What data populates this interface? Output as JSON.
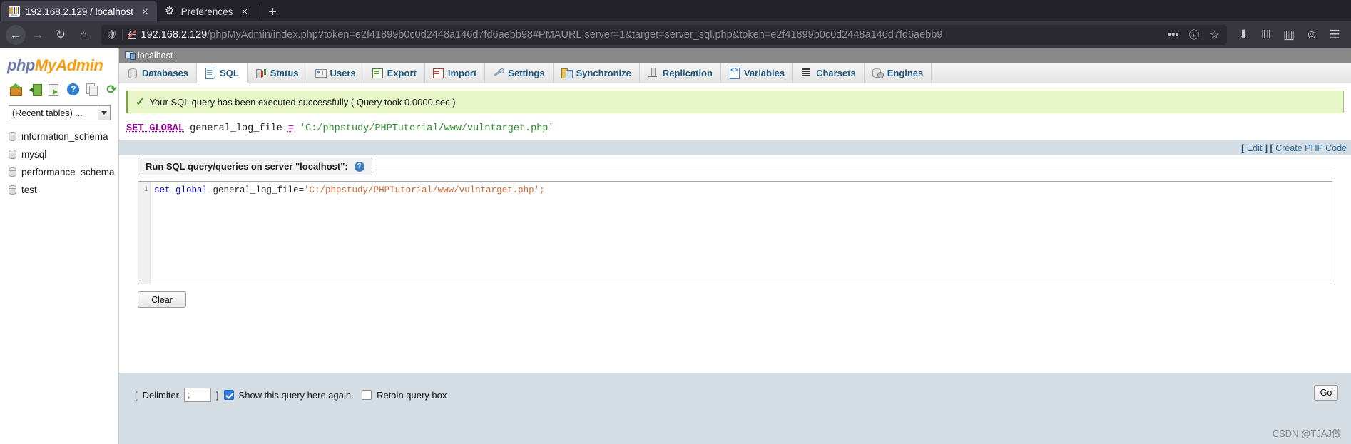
{
  "browser": {
    "tabs": [
      {
        "title": "192.168.2.129 / localhost",
        "favicon": "phpmyadmin-icon",
        "active": true,
        "close_label": "×"
      },
      {
        "title": "Preferences",
        "favicon": "gear-icon",
        "active": false,
        "close_label": "×"
      }
    ],
    "new_tab_label": "+",
    "nav": {
      "back": "←",
      "forward": "→",
      "reload": "↻",
      "home": "⌂"
    },
    "url": {
      "host": "192.168.2.129",
      "path": "/phpMyAdmin/index.php?token=e2f41899b0c0d2448a146d7fd6aebb98#PMAURL:server=1&target=server_sql.php&token=e2f41899b0c0d2448a146d7fd6aebb9",
      "full": "192.168.2.129/phpMyAdmin/index.php?token=e2f41899b0c0d2448a146d7fd6aebb98#PMAURL:server=1&target=server_sql.php&token=e2f41899b0c0d2448a146d7fd6aebb9",
      "more_label": "•••",
      "pocket_label": "ⓥ",
      "star_label": "☆"
    },
    "toolbar_right": {
      "downloads": "⬇",
      "library": "‖‖",
      "sidebar": "▥",
      "account": "☺",
      "menu": "☰"
    }
  },
  "sidebar": {
    "logo": {
      "php": "php",
      "my": "My",
      "admin": "Admin"
    },
    "icons": [
      {
        "name": "home-icon",
        "cls": "ic-home"
      },
      {
        "name": "logout-door-icon",
        "cls": "ic-door"
      },
      {
        "name": "export-doc-icon",
        "cls": "ic-docexp"
      },
      {
        "name": "help-icon",
        "cls": "ic-help"
      },
      {
        "name": "copy-doc-icon",
        "cls": "ic-copy"
      },
      {
        "name": "reload-icon",
        "cls": "ic-refresh"
      }
    ],
    "recent_tables_label": "(Recent tables) ...",
    "databases": [
      "information_schema",
      "mysql",
      "performance_schema",
      "test"
    ]
  },
  "main": {
    "server_label": "localhost",
    "tabs": [
      {
        "label": "Databases",
        "icon": "ti-db",
        "active": false
      },
      {
        "label": "SQL",
        "icon": "ti-sql",
        "active": true
      },
      {
        "label": "Status",
        "icon": "ti-status",
        "active": false
      },
      {
        "label": "Users",
        "icon": "ti-users",
        "active": false
      },
      {
        "label": "Export",
        "icon": "ti-export",
        "active": false
      },
      {
        "label": "Import",
        "icon": "ti-import",
        "active": false
      },
      {
        "label": "Settings",
        "icon": "ti-settings",
        "active": false
      },
      {
        "label": "Synchronize",
        "icon": "ti-sync",
        "active": false
      },
      {
        "label": "Replication",
        "icon": "ti-repl",
        "active": false
      },
      {
        "label": "Variables",
        "icon": "ti-var",
        "active": false
      },
      {
        "label": "Charsets",
        "icon": "ti-charset",
        "active": false
      },
      {
        "label": "Engines",
        "icon": "ti-engines",
        "active": false
      }
    ],
    "success_message": "Your SQL query has been executed successfully ( Query took 0.0000 sec )",
    "executed_sql": {
      "keyword": "SET GLOBAL",
      "identifier": "general_log_file",
      "operator": "=",
      "value": "'C:/phpstudy/PHPTutorial/www/vulntarget.php'"
    },
    "action_links": {
      "open_bracket": "[",
      "edit": "Edit",
      "close_bracket": "]",
      "open_bracket2": "[",
      "create_php_code": "Create PHP Code"
    },
    "query_panel": {
      "legend": "Run SQL query/queries on server \"localhost\":",
      "help_glyph": "?",
      "line_number": "1",
      "code_keyword": "set global",
      "code_identifier": " general_log_file=",
      "code_string": "'C:/phpstudy/PHPTutorial/www/vulntarget.php';",
      "clear_label": "Clear"
    },
    "footer": {
      "bracket_open": "[",
      "delimiter_label": "Delimiter",
      "delimiter_value": ";",
      "bracket_close": "]",
      "show_query_label": "Show this query here again",
      "show_query_checked": true,
      "retain_query_label": "Retain query box",
      "retain_query_checked": false,
      "go_label": "Go"
    },
    "watermark": "CSDN @TJAJ做"
  }
}
